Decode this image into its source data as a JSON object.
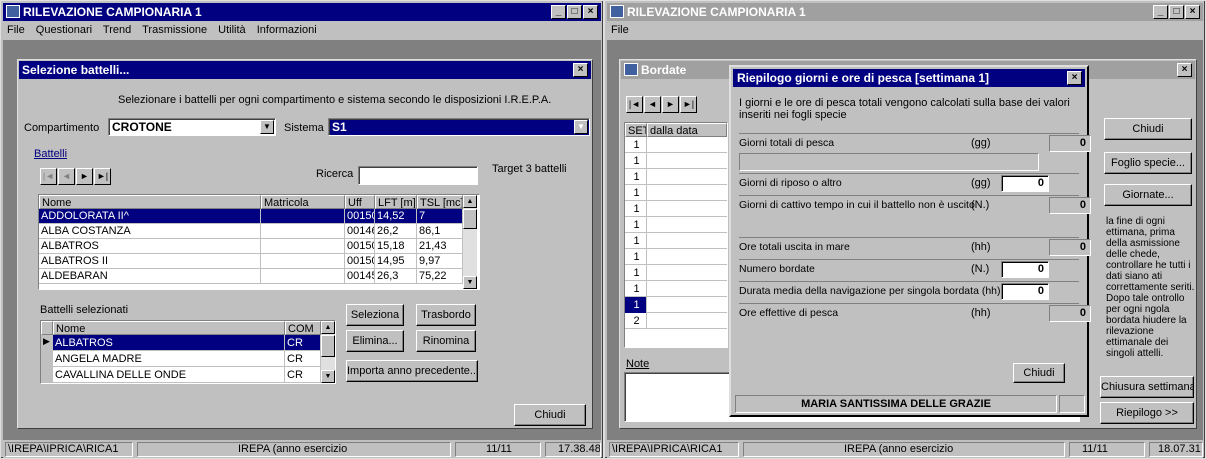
{
  "left": {
    "title": "RILEVAZIONE CAMPIONARIA 1",
    "menu": [
      "File",
      "Questionari",
      "Trend",
      "Trasmissione",
      "Utilità",
      "Informazioni"
    ],
    "dialog_title": "Selezione  battelli...",
    "instruction": "Selezionare i battelli per ogni compartimento e sistema secondo le disposizioni I.R.E.P.A.",
    "compartimento_label": "Compartimento",
    "compartimento_value": "CROTONE",
    "sistema_label": "Sistema",
    "sistema_value": "S1",
    "battelli_group": "Battelli",
    "ricerca_label": "Ricerca",
    "target": "Target 3 battelli",
    "columns": [
      "Nome",
      "Matricola",
      "Uff",
      "LFT [m]",
      "TSL [mc]"
    ],
    "rows": [
      [
        "ADDOLORATA II^",
        "",
        "00150",
        "14,52",
        "7"
      ],
      [
        "ALBA COSTANZA",
        "",
        "00146",
        "26,2",
        "86,1"
      ],
      [
        "ALBATROS",
        "",
        "00150",
        "15,18",
        "21,43"
      ],
      [
        "ALBATROS II",
        "",
        "00150",
        "14,95",
        "9,97"
      ],
      [
        "ALDEBARAN",
        "",
        "00145",
        "26,3",
        "75,22"
      ]
    ],
    "selected_title": "Battelli selezionati",
    "sel_columns": [
      "Nome",
      "COM"
    ],
    "sel_rows": [
      [
        "ALBATROS",
        "CR"
      ],
      [
        "ANGELA MADRE",
        "CR"
      ],
      [
        "CAVALLINA DELLE ONDE",
        "CR"
      ]
    ],
    "btn_seleziona": "Seleziona",
    "btn_trasbordo": "Trasbordo",
    "btn_elimina": "Elimina...",
    "btn_rinomina": "Rinomina",
    "btn_importa": "Importa anno precedente...",
    "btn_chiudi": "Chiudi",
    "status": [
      "\\IREPA\\IPRICA\\RICA1",
      "IREPA (anno esercizio",
      "11/11",
      "17.38.48"
    ]
  },
  "right": {
    "title": "RILEVAZIONE CAMPIONARIA 1",
    "menu": [
      "File"
    ],
    "child_title": "Bordate",
    "set_header": [
      "SET",
      "dalla data"
    ],
    "set_rows": [
      "1",
      "1",
      "1",
      "1",
      "1",
      "1",
      "1",
      "1",
      "1",
      "1",
      "1",
      "2"
    ],
    "note_label": "Note",
    "dialog_title": "Riepilogo giorni e ore di pesca [settimana 1]",
    "dialog_info": "I giorni e le ore di pesca totali vengono calcolati sulla base dei valori inseriti nei fogli specie",
    "fields": [
      {
        "label": "Giorni totali di pesca",
        "unit": "(gg)",
        "value": "0",
        "editable": false
      },
      {
        "label": "Giorni di riposo o altro",
        "unit": "(gg)",
        "value": "0",
        "editable": true
      },
      {
        "label": "Giorni di cattivo tempo in cui il battello non è uscito",
        "unit": "(N.)",
        "value": "0",
        "editable": false
      },
      {
        "label": "Ore totali uscita in mare",
        "unit": "(hh)",
        "value": "0",
        "editable": false
      },
      {
        "label": "Numero bordate",
        "unit": "(N.)",
        "value": "0",
        "editable": true
      },
      {
        "label": "Durata media della navigazione per singola bordata (hh)",
        "unit": "",
        "value": "0",
        "editable": true
      },
      {
        "label": "Ore effettive di pesca",
        "unit": "(hh)",
        "value": "0",
        "editable": false
      }
    ],
    "dialog_chiudi": "Chiudi",
    "vessel_name": "MARIA SANTISSIMA DELLE GRAZIE",
    "side_chiudi": "Chiudi",
    "side_foglio": "Foglio specie...",
    "side_giornate": "Giornate...",
    "side_text": "la fine di ogni ettimana, prima della asmissione delle chede, controllare he tutti i dati siano ati correttamente seriti. Dopo tale ontrollo per ogni ngola bordata hiudere la rilevazione ettimanale dei singoli attelli.",
    "side_chiusura": "Chiusura settimana",
    "side_riepilogo": "Riepilogo >>",
    "status": [
      "\\IREPA\\IPRICA\\RICA1",
      "IREPA (anno esercizio",
      "11/11",
      "18.07.31"
    ]
  }
}
